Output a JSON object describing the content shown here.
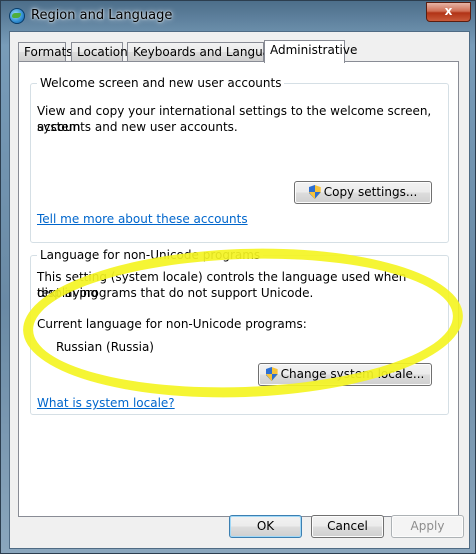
{
  "window": {
    "title": "Region and Language",
    "close_label": "x"
  },
  "tabs": [
    {
      "label": "Formats"
    },
    {
      "label": "Location"
    },
    {
      "label": "Keyboards and Languages"
    },
    {
      "label": "Administrative",
      "active": true
    }
  ],
  "welcome_group": {
    "title": "Welcome screen and new user accounts",
    "description_line1": "View and copy your international settings to the welcome screen, system",
    "description_line2": "accounts and new user accounts.",
    "copy_button_label": "Copy settings...",
    "link_label": "Tell me more about these accounts"
  },
  "nonunicode_group": {
    "title": "Language for non-Unicode programs",
    "description_line1": "This setting (system locale) controls the language used when displaying",
    "description_line2": "text in programs that do not support Unicode.",
    "current_label": "Current language for non-Unicode programs:",
    "current_value": "Russian (Russia)",
    "change_button_label": "Change system locale...",
    "link_label": "What is system locale?"
  },
  "dialog_buttons": {
    "ok": "OK",
    "cancel": "Cancel",
    "apply": "Apply"
  },
  "colors": {
    "highlight": "#f4f423",
    "link": "#0066cc"
  },
  "icons": {
    "shield": "uac-shield-icon",
    "app": "globe-icon"
  }
}
